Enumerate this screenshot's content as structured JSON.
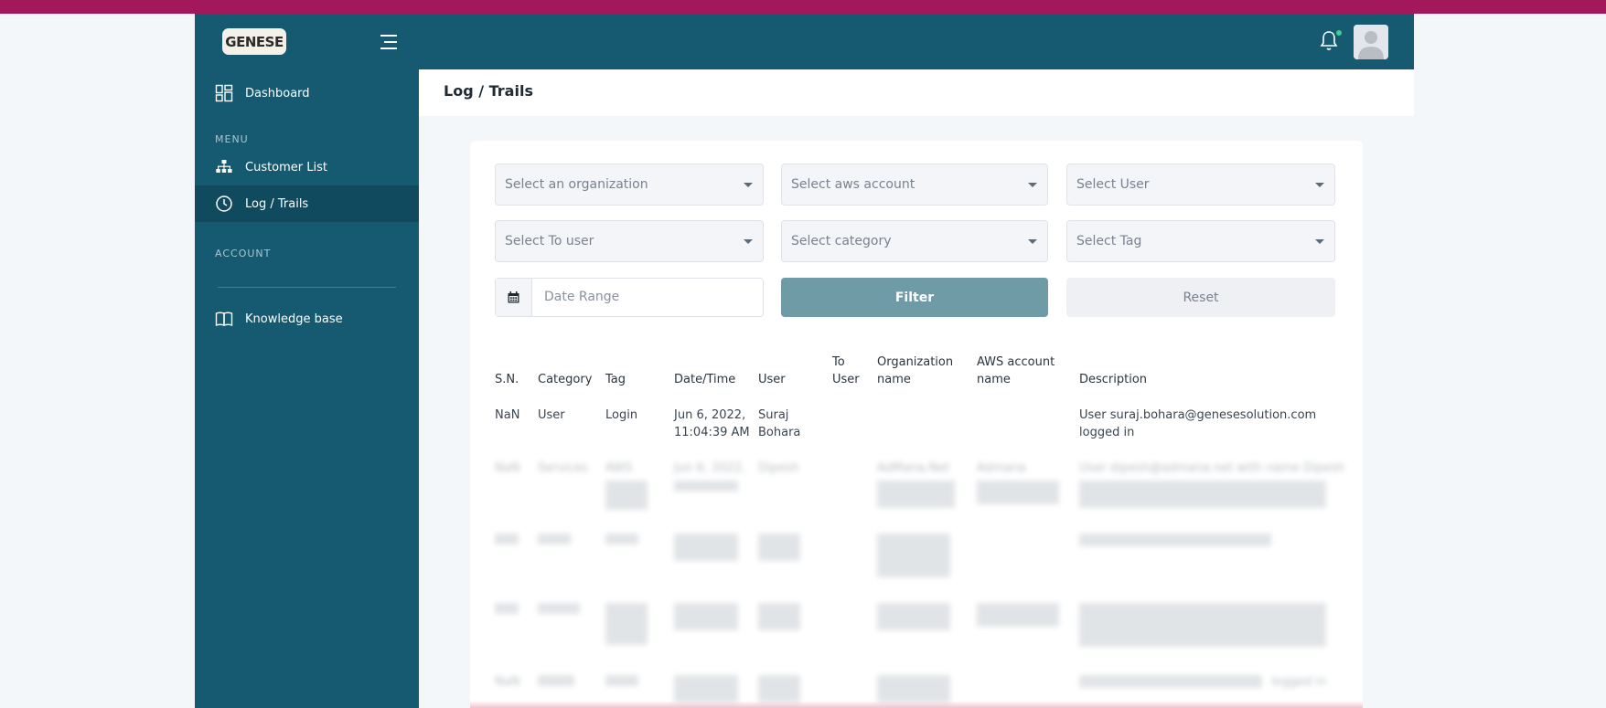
{
  "sidebar": {
    "logo_text": "GENESE",
    "items": {
      "dashboard": "Dashboard",
      "customer_list": "Customer List",
      "log_trails": "Log / Trails",
      "knowledge_base": "Knowledge base"
    },
    "sections": {
      "menu": "MENU",
      "account": "ACCOUNT"
    },
    "active_item": "Log / Trails"
  },
  "header": {
    "notification_icon": "bell-icon",
    "avatar": "user-avatar"
  },
  "page": {
    "title": "Log / Trails"
  },
  "filters": {
    "organization": "Select an organization",
    "aws_account": "Select aws account",
    "user": "Select User",
    "to_user": "Select To user",
    "category": "Select category",
    "tag": "Select Tag",
    "date_range_placeholder": "Date Range",
    "filter_label": "Filter",
    "reset_label": "Reset"
  },
  "table": {
    "headers": {
      "sn": "S.N.",
      "category": "Category",
      "tag": "Tag",
      "datetime": "Date/Time",
      "user": "User",
      "to_user_1": "To",
      "to_user_2": "User",
      "org_1": "Organization",
      "org_2": "name",
      "aws_1": "AWS account",
      "aws_2": "name",
      "description": "Description"
    },
    "rows": [
      {
        "sn": "NaN",
        "category": "User",
        "tag": "Login",
        "date_1": "Jun 6, 2022,",
        "date_2": "11:04:39 AM",
        "user_1": "Suraj",
        "user_2": "Bohara",
        "desc_1": "User suraj.bohara@genesesolution.com",
        "desc_2": "logged in"
      }
    ],
    "blurred_rows": {
      "r2_sn": "NaN",
      "r2_category": "Services",
      "r2_tag": "AWS",
      "r2_date": "Jun 6, 2022,",
      "r2_user": "Dipesh",
      "r2_org": "AdMana.Net",
      "r2_aws": "Admana",
      "r2_desc": "User dipesh@admana.net with name Dipesh",
      "r5_sn": "NaN",
      "r5_desc": "logged in"
    }
  },
  "colors": {
    "sidebar_bg": "#155a70",
    "active_item_bg": "#0f4a5e",
    "filter_button": "#6f9ba7",
    "browser_bar": "#a2185a",
    "notification_dot": "#3ecf8e"
  }
}
